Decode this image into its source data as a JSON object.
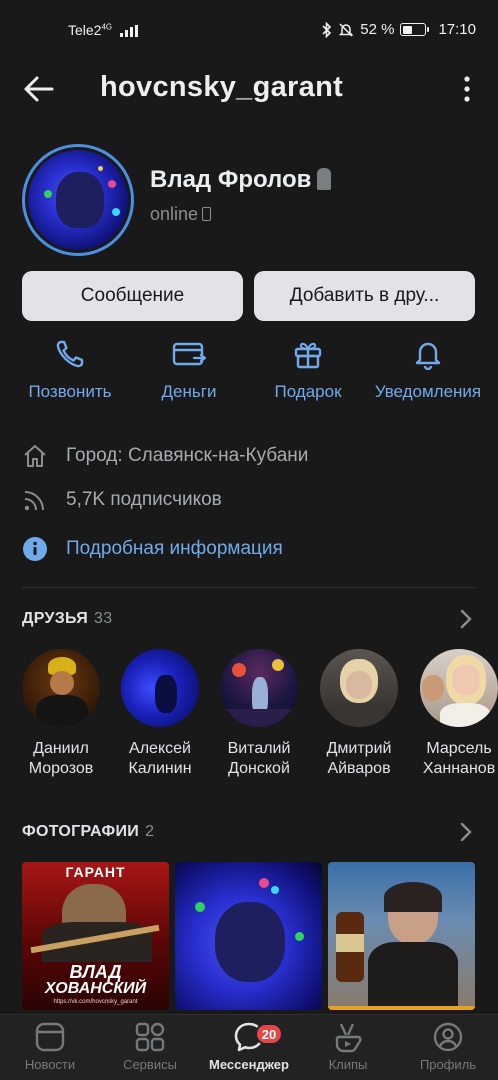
{
  "status_bar": {
    "carrier": "Tele2",
    "network": "4G",
    "battery_text": "52 %",
    "battery_level": 0.52,
    "time": "17:10"
  },
  "header": {
    "title": "hovcnsky_garant"
  },
  "profile": {
    "name": "Влад Фролов",
    "status": "online"
  },
  "buttons": {
    "message": "Сообщение",
    "add_friend": "Добавить в дру..."
  },
  "actions": [
    {
      "label": "Позвонить",
      "icon": "phone-icon"
    },
    {
      "label": "Деньги",
      "icon": "money-icon"
    },
    {
      "label": "Подарок",
      "icon": "gift-icon"
    },
    {
      "label": "Уведомления",
      "icon": "bell-icon"
    }
  ],
  "info": {
    "city": "Город: Славянск-на-Кубани",
    "followers": "5,7K подписчиков",
    "details_link": "Подробная информация"
  },
  "friends": {
    "title": "ДРУЗЬЯ",
    "count": "33",
    "items": [
      {
        "first": "Даниил",
        "last": "Морозов"
      },
      {
        "first": "Алексей",
        "last": "Калинин"
      },
      {
        "first": "Виталий",
        "last": "Донской"
      },
      {
        "first": "Дмитрий",
        "last": "Айваров"
      },
      {
        "first": "Марсель",
        "last": "Ханнанов"
      }
    ]
  },
  "photos": {
    "title": "ФОТОГРАФИИ",
    "count": "2",
    "poster": {
      "top": "ГАРАНТ",
      "line1": "ВЛАД",
      "line2": "ХОВАНСКИЙ",
      "url": "https://vk.com/hovcnsky_garant"
    }
  },
  "tabbar": {
    "tabs": [
      {
        "label": "Новости",
        "icon": "news-icon"
      },
      {
        "label": "Сервисы",
        "icon": "services-icon"
      },
      {
        "label": "Мессенджер",
        "icon": "messenger-icon",
        "active": true,
        "badge": "20"
      },
      {
        "label": "Клипы",
        "icon": "clips-icon"
      },
      {
        "label": "Профиль",
        "icon": "profile-icon"
      }
    ]
  },
  "colors": {
    "background": "#19191a",
    "accent": "#71aaeb",
    "badge": "#e64646"
  }
}
